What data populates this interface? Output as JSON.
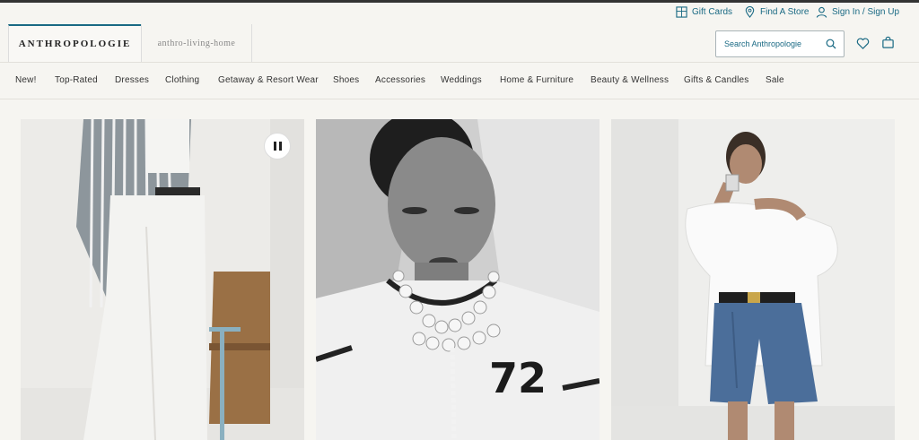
{
  "utility": {
    "gift_cards": "Gift Cards",
    "find_store": "Find A Store",
    "sign_in": "Sign In / Sign Up"
  },
  "header": {
    "logo": "ANTHROPOLOGIE",
    "sub_logo": "anthro-living-home",
    "search_placeholder": "Search Anthropologie"
  },
  "nav": {
    "items": [
      "New!",
      "Top-Rated",
      "Dresses",
      "Clothing",
      "Getaway & Resort Wear",
      "Shoes",
      "Accessories",
      "Weddings",
      "Home & Furniture",
      "Beauty & Wellness",
      "Gifts & Candles",
      "Sale"
    ]
  },
  "hero": {
    "jersey_number": "72"
  },
  "colors": {
    "accent": "#1a6a84",
    "background": "#f6f5f1"
  },
  "icons": [
    "gift-card-icon",
    "location-pin-icon",
    "user-icon",
    "search-icon",
    "heart-icon",
    "bag-icon",
    "pause-icon"
  ]
}
